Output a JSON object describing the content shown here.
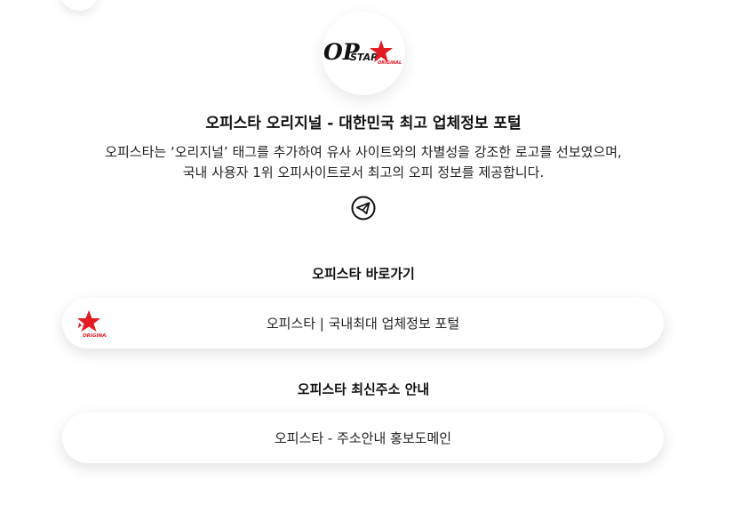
{
  "profile": {
    "logo_name": "opstar-original-logo",
    "logo_text_op": "OP",
    "logo_text_star": "STAR",
    "logo_text_original": "ORIGINAL",
    "title": "오피스타 오리지널 - 대한민국 최고 업체정보 포털",
    "description_lines": [
      "오피스타는 ‘오리지널’ 태그를 추가하여 유사 사이트와의 차별성을 강조한 로고를 선보였으며,",
      "국내 사용자 1위 오피사이트로서 최고의 오피 정보를 제공합니다."
    ],
    "social_icon": "telegram-icon"
  },
  "sections": [
    {
      "title": "오피스타 바로가기",
      "link": {
        "label": "오피스타 | 국내최대 업체정보 포털",
        "thumb_icon": "opstar-star-thumbnail"
      }
    },
    {
      "title": "오피스타 최신주소 안내",
      "link": {
        "label": "오피스타 - 주소안내 홍보도메인"
      }
    }
  ],
  "colors": {
    "brand_red": "#e31b23",
    "text": "#222222",
    "heading": "#111111",
    "background": "#ffffff"
  }
}
